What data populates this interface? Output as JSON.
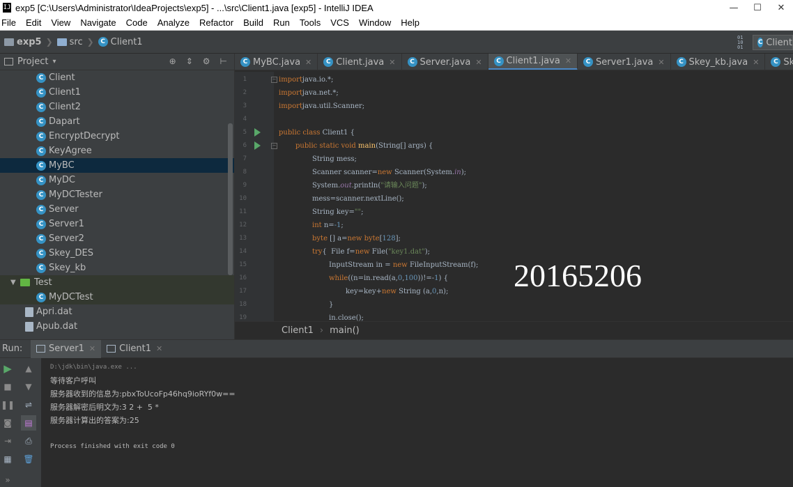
{
  "window": {
    "title": "exp5 [C:\\Users\\Administrator\\IdeaProjects\\exp5] - ...\\src\\Client1.java [exp5] - IntelliJ IDEA",
    "app_icon": "IJ"
  },
  "menu": [
    "File",
    "Edit",
    "View",
    "Navigate",
    "Code",
    "Analyze",
    "Refactor",
    "Build",
    "Run",
    "Tools",
    "VCS",
    "Window",
    "Help"
  ],
  "navbar": {
    "crumbs": [
      "exp5",
      "src",
      "Client1"
    ],
    "run_config": "Client",
    "binary_icon": "01\n10\n01"
  },
  "project": {
    "label": "Project",
    "dropdown": "▾",
    "tools": [
      "⊕",
      "⇕",
      "⚙",
      "⊢"
    ],
    "items": [
      {
        "kind": "class",
        "label": "Client"
      },
      {
        "kind": "class",
        "label": "Client1"
      },
      {
        "kind": "class",
        "label": "Client2"
      },
      {
        "kind": "class",
        "label": "Dapart"
      },
      {
        "kind": "class",
        "label": "EncryptDecrypt"
      },
      {
        "kind": "class",
        "label": "KeyAgree"
      },
      {
        "kind": "class",
        "label": "MyBC",
        "selected": true
      },
      {
        "kind": "class",
        "label": "MyDC"
      },
      {
        "kind": "class",
        "label": "MyDCTester"
      },
      {
        "kind": "class",
        "label": "Server"
      },
      {
        "kind": "class",
        "label": "Server1"
      },
      {
        "kind": "class",
        "label": "Server2"
      },
      {
        "kind": "class",
        "label": "Skey_DES"
      },
      {
        "kind": "class",
        "label": "Skey_kb"
      },
      {
        "kind": "folder",
        "label": "Test"
      },
      {
        "kind": "class",
        "label": "MyDCTest",
        "test": true
      },
      {
        "kind": "file",
        "label": "Apri.dat"
      },
      {
        "kind": "file",
        "label": "Apub.dat"
      }
    ]
  },
  "tabs": [
    {
      "label": "MyBC.java",
      "active": false
    },
    {
      "label": "Client.java",
      "active": false
    },
    {
      "label": "Server.java",
      "active": false
    },
    {
      "label": "Client1.java",
      "active": true
    },
    {
      "label": "Server1.java",
      "active": false
    },
    {
      "label": "Skey_kb.java",
      "active": false
    },
    {
      "label": "Skey_DES.java",
      "active": false
    }
  ],
  "code_lines": [
    {
      "n": "1",
      "indent": 0,
      "parts": [
        [
          "kw",
          "import"
        ],
        [
          "",
          "java.io.*;"
        ]
      ]
    },
    {
      "n": "2",
      "indent": 0,
      "parts": [
        [
          "kw",
          "import"
        ],
        [
          "",
          "java.net.*;"
        ]
      ]
    },
    {
      "n": "3",
      "indent": 0,
      "parts": [
        [
          "kw",
          "import"
        ],
        [
          "",
          "java.util.Scanner;"
        ]
      ]
    },
    {
      "n": "4",
      "indent": 0,
      "parts": []
    },
    {
      "n": "5",
      "indent": 0,
      "parts": [
        [
          "kw",
          "public class "
        ],
        [
          "",
          "Client1 {"
        ]
      ]
    },
    {
      "n": "6",
      "indent": 1,
      "parts": [
        [
          "kw",
          "public static void "
        ],
        [
          "fn",
          "main"
        ],
        [
          "",
          "(String[] args) {"
        ]
      ]
    },
    {
      "n": "7",
      "indent": 2,
      "parts": [
        [
          "",
          "String mess;"
        ]
      ]
    },
    {
      "n": "8",
      "indent": 2,
      "parts": [
        [
          "",
          "Scanner scanner="
        ],
        [
          "kw",
          "new "
        ],
        [
          "",
          "Scanner(System."
        ],
        [
          "italic-field",
          "in"
        ],
        [
          "",
          ");"
        ]
      ]
    },
    {
      "n": "9",
      "indent": 2,
      "parts": [
        [
          "",
          "System."
        ],
        [
          "italic-field",
          "out"
        ],
        [
          "",
          ".println("
        ],
        [
          "str",
          "\"请输入问题\""
        ],
        [
          "",
          ");"
        ]
      ]
    },
    {
      "n": "10",
      "indent": 2,
      "parts": [
        [
          "",
          "mess=scanner.nextLine();"
        ]
      ]
    },
    {
      "n": "11",
      "indent": 2,
      "parts": [
        [
          "",
          "String key="
        ],
        [
          "str",
          "\"\""
        ],
        [
          "",
          ";"
        ]
      ]
    },
    {
      "n": "12",
      "indent": 2,
      "parts": [
        [
          "kw",
          "int "
        ],
        [
          "",
          "n="
        ],
        [
          "num",
          "-1"
        ],
        [
          "",
          ";"
        ]
      ]
    },
    {
      "n": "13",
      "indent": 2,
      "parts": [
        [
          "kw",
          "byte "
        ],
        [
          "",
          "[] a="
        ],
        [
          "kw",
          "new byte"
        ],
        [
          "",
          "["
        ],
        [
          "num",
          "128"
        ],
        [
          "",
          "];"
        ]
      ]
    },
    {
      "n": "14",
      "indent": 2,
      "parts": [
        [
          "kw",
          "try"
        ],
        [
          "",
          "{  File f="
        ],
        [
          "kw",
          "new "
        ],
        [
          "",
          "File("
        ],
        [
          "str",
          "\"key1.dat\""
        ],
        [
          "",
          ");"
        ]
      ]
    },
    {
      "n": "15",
      "indent": 3,
      "parts": [
        [
          "",
          "InputStream in = "
        ],
        [
          "kw",
          "new "
        ],
        [
          "",
          "FileInputStream(f);"
        ]
      ]
    },
    {
      "n": "16",
      "indent": 3,
      "parts": [
        [
          "kw",
          "while"
        ],
        [
          "",
          "((n=in.read(a,"
        ],
        [
          "num",
          "0"
        ],
        [
          "",
          ","
        ],
        [
          "num",
          "100"
        ],
        [
          "",
          "))!=-"
        ],
        [
          "num",
          "1"
        ],
        [
          "",
          ") {"
        ]
      ]
    },
    {
      "n": "17",
      "indent": 4,
      "parts": [
        [
          "",
          "key=key+"
        ],
        [
          "kw",
          "new "
        ],
        [
          "",
          "String (a,"
        ],
        [
          "num",
          "0"
        ],
        [
          "",
          ",n);"
        ]
      ]
    },
    {
      "n": "18",
      "indent": 3,
      "parts": [
        [
          "",
          "}"
        ]
      ]
    },
    {
      "n": "19",
      "indent": 3,
      "parts": [
        [
          "",
          "in.close();"
        ]
      ]
    }
  ],
  "watermark": "20165206",
  "editor_breadcrumb": [
    "Client1",
    "main()"
  ],
  "run": {
    "label": "Run:",
    "tabs": [
      {
        "label": "Server1",
        "active": true
      },
      {
        "label": "Client1",
        "active": false
      }
    ],
    "console": [
      {
        "kind": "cmd",
        "text": "D:\\jdk\\bin\\java.exe ..."
      },
      {
        "kind": "cjk",
        "text": "等待客户呼叫"
      },
      {
        "kind": "cjk",
        "text": "服务器收到的信息为:pbxToUcoFp46hq9ioRYf0w=="
      },
      {
        "kind": "cjk",
        "text": "服务器解密后明文为:3 2 +  5 *"
      },
      {
        "kind": "cjk",
        "text": "服务器计算出的答案为:25"
      },
      {
        "kind": "cjk",
        "text": ""
      },
      {
        "kind": "mono",
        "text": "Process finished with exit code 0"
      }
    ]
  },
  "colors": {
    "accent": "#4a88c7",
    "run_green": "#59a869",
    "selection": "#0d293e"
  }
}
